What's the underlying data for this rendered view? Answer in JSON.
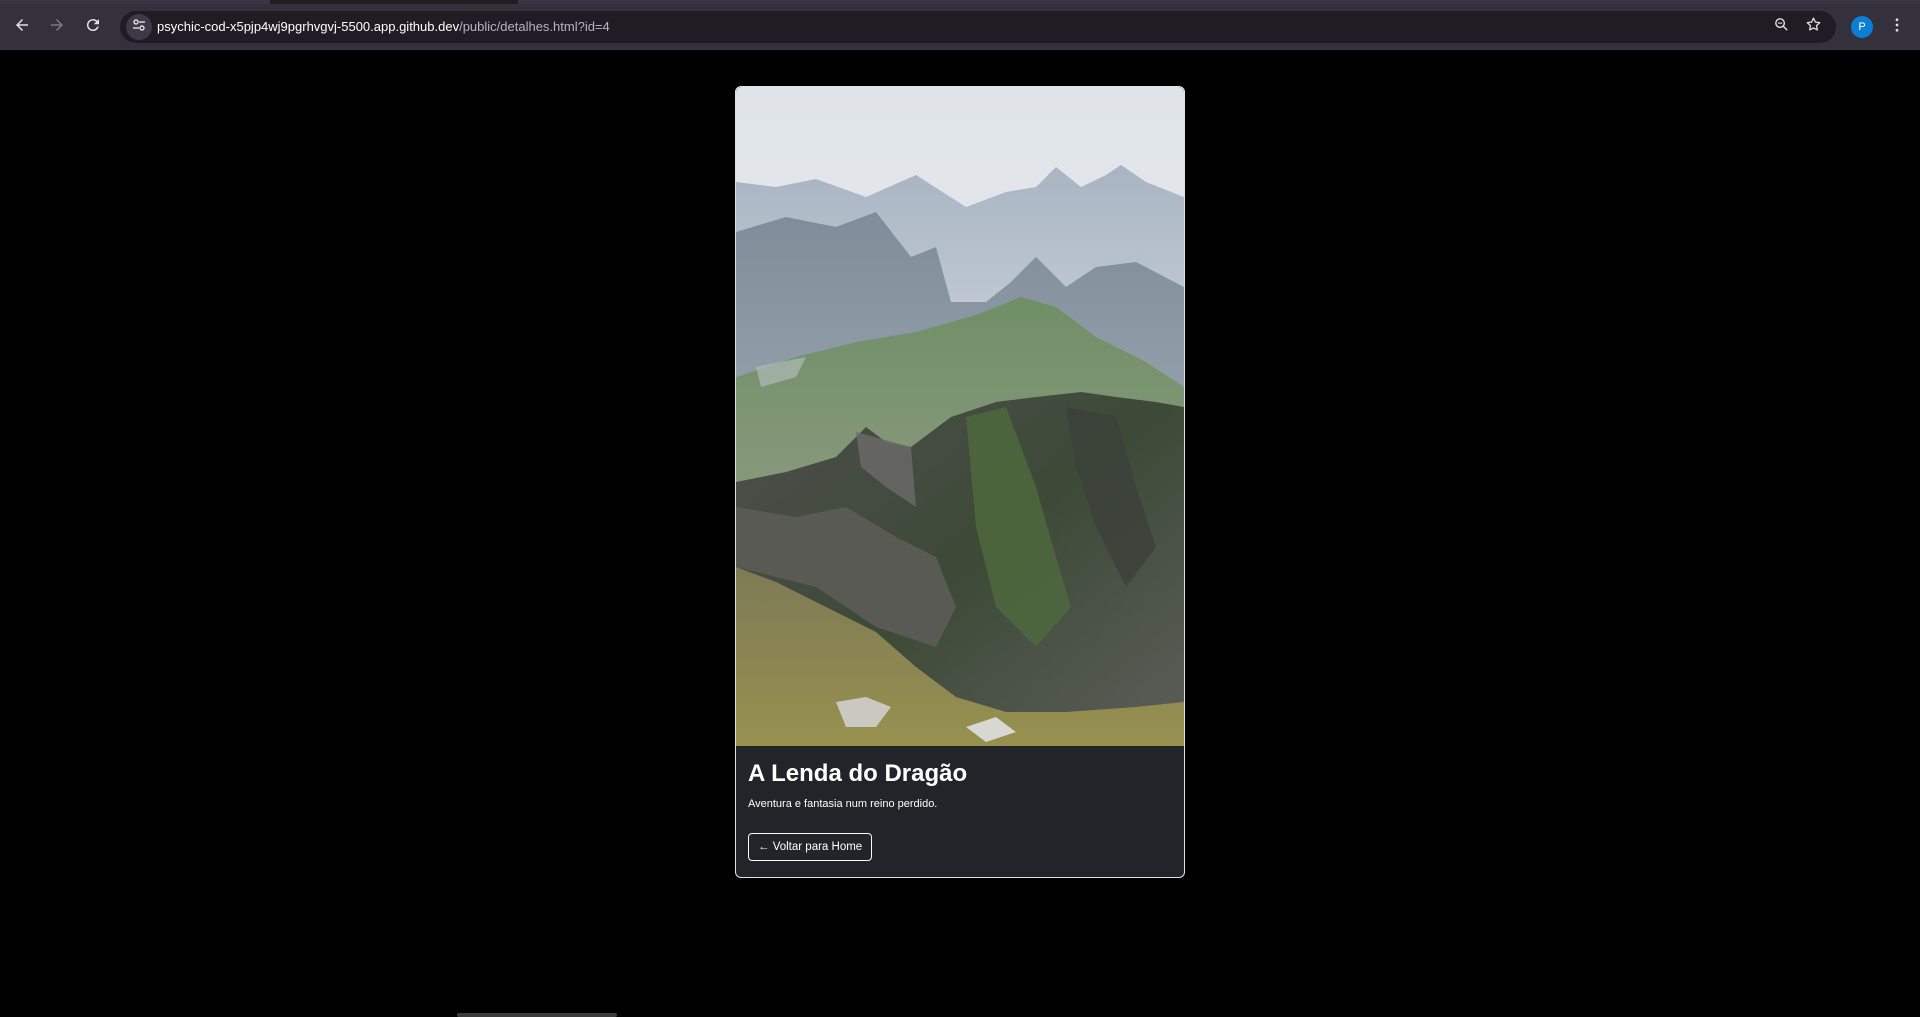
{
  "browser": {
    "url_host": "psychic-cod-x5pjp4wj9pgrhvgvj-5500.app.github.dev",
    "url_path": "/public/detalhes.html?id=4",
    "profile_initial": "P",
    "icons": {
      "back": "back-arrow-icon",
      "forward": "forward-arrow-icon",
      "reload": "reload-icon",
      "site_info": "tune-icon",
      "zoom": "zoom-icon",
      "bookmark": "star-icon",
      "menu": "kebab-menu-icon"
    }
  },
  "card": {
    "image_alt": "mountain landscape",
    "title": "A Lenda do Dragão",
    "description": "Aventura e fantasia num reino perdido.",
    "back_button_label": "← Voltar para Home"
  },
  "colors": {
    "page_background": "#000000",
    "card_background": "#212529",
    "card_border": "#dee2e6",
    "toolbar": "#35313c",
    "omnibox": "#1f1c24",
    "avatar": "#0b7fd4"
  }
}
